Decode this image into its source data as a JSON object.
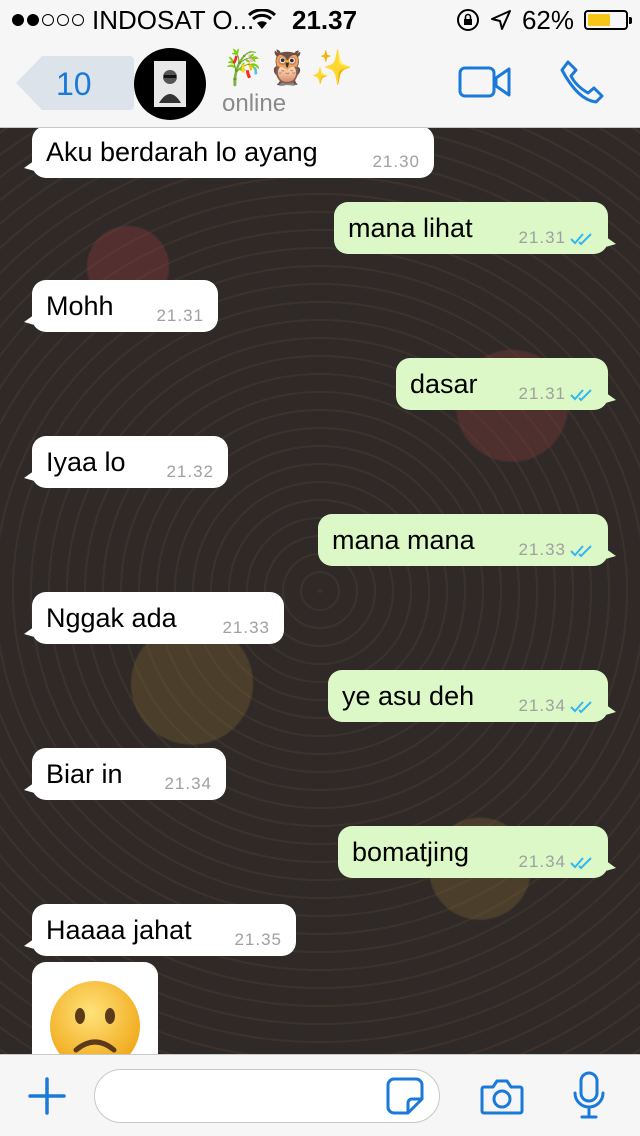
{
  "status_bar": {
    "carrier": "INDOSAT O...",
    "time": "21.37",
    "battery_percent": "62%",
    "battery_level": 0.62,
    "signal_dots_filled": 2,
    "signal_dots_total": 5,
    "icons": [
      "wifi-icon",
      "rotation-lock-icon",
      "location-arrow-icon",
      "battery-icon"
    ]
  },
  "header": {
    "back_count": "10",
    "contact_name": "🎋🦉✨",
    "contact_status": "online",
    "accent_color": "#1a7ad9"
  },
  "messages": [
    {
      "dir": "in",
      "text": "Aku berdarah lo ayang",
      "time": "21.30"
    },
    {
      "dir": "out",
      "text": "mana lihat",
      "time": "21.31",
      "read": true
    },
    {
      "dir": "in",
      "text": "Mohh",
      "time": "21.31"
    },
    {
      "dir": "out",
      "text": "dasar",
      "time": "21.31",
      "read": true
    },
    {
      "dir": "in",
      "text": "Iyaa lo",
      "time": "21.32"
    },
    {
      "dir": "out",
      "text": "mana mana",
      "time": "21.33",
      "read": true
    },
    {
      "dir": "in",
      "text": "Nggak ada",
      "time": "21.33"
    },
    {
      "dir": "out",
      "text": "ye asu deh",
      "time": "21.34",
      "read": true
    },
    {
      "dir": "in",
      "text": "Biar in",
      "time": "21.34"
    },
    {
      "dir": "out",
      "text": "bomatjing",
      "time": "21.34",
      "read": true
    },
    {
      "dir": "in",
      "text": "Haaaa jahat",
      "time": "21.35"
    },
    {
      "dir": "in",
      "emoji": "☹️"
    }
  ],
  "input_bar": {
    "placeholder": "",
    "icons": [
      "plus-icon",
      "sticker-icon",
      "camera-icon",
      "microphone-icon"
    ]
  },
  "colors": {
    "incoming_bubble": "#ffffff",
    "outgoing_bubble": "#dcf8c6",
    "read_ticks": "#34b7f1"
  }
}
